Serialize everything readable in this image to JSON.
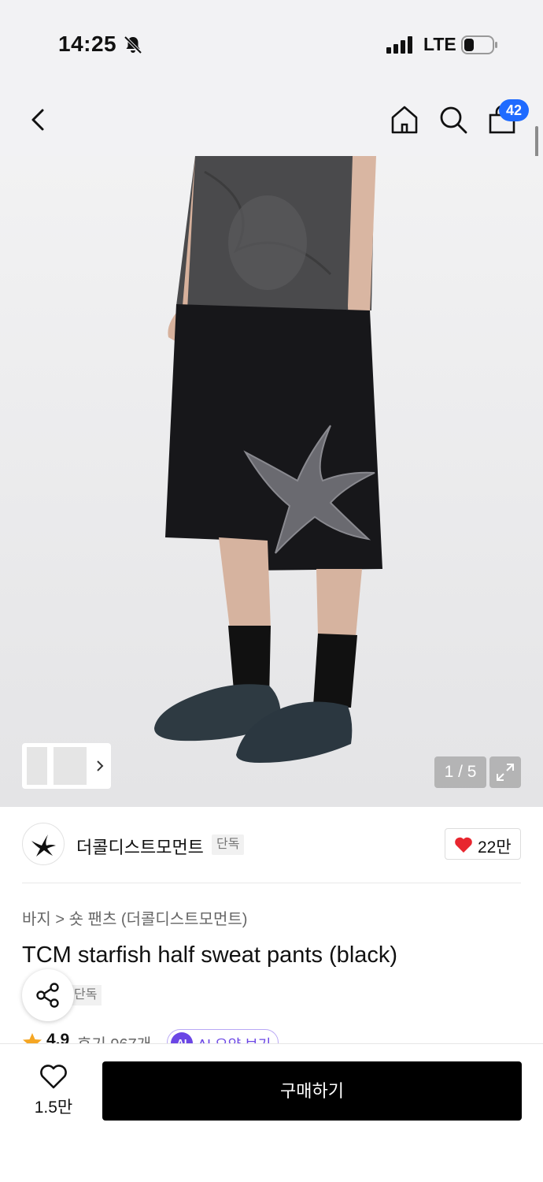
{
  "status_bar": {
    "time": "14:25",
    "network": "LTE"
  },
  "nav": {
    "cart_count": "42"
  },
  "gallery": {
    "page_counter": "1 / 5"
  },
  "brand": {
    "name": "더콜디스트모먼트",
    "tag": "단독",
    "likes": "22만"
  },
  "product": {
    "breadcrumb": "바지 > 숏 팬츠 (더콜디스트모먼트)",
    "title": "TCM starfish half sweat pants (black)",
    "tag": "단독",
    "rating": "4.9",
    "reviews": "후기 967개",
    "ai_summary": "AI 요약 보기",
    "ai_badge": "AI"
  },
  "bottom_bar": {
    "wish_count": "1.5만",
    "buy_label": "구매하기"
  },
  "colors": {
    "accent_blue": "#1f6bff",
    "heart_red": "#e8262f",
    "ai_purple": "#6b46e5",
    "star_orange": "#f5a623"
  }
}
